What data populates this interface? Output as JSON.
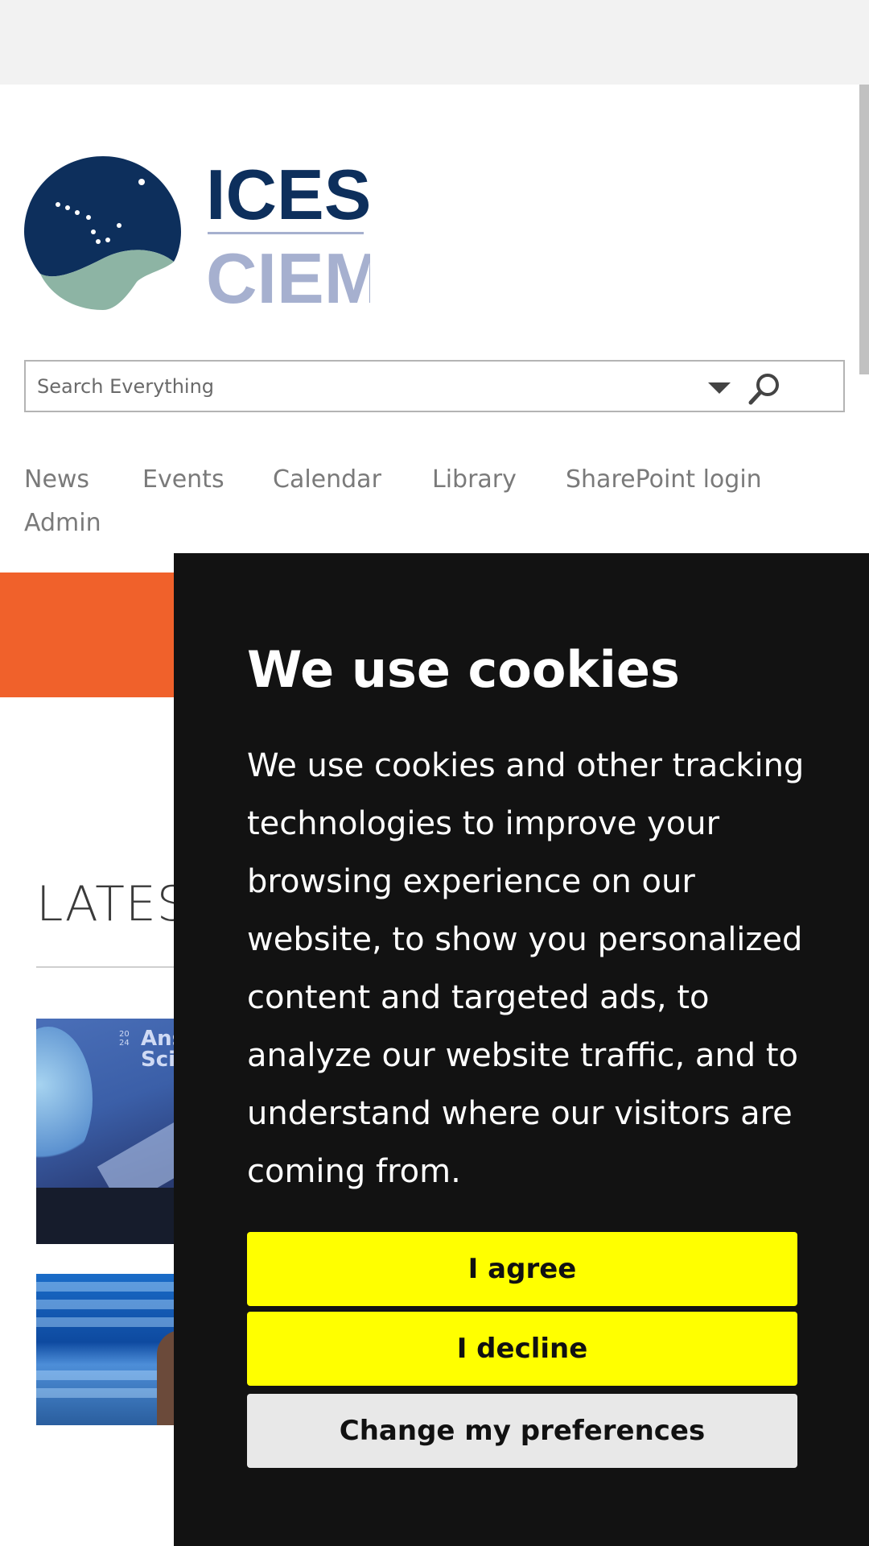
{
  "logo": {
    "line1": "ICES",
    "line2": "CIEM",
    "colors": {
      "navy": "#0d2f5c",
      "green": "#8db4a4",
      "lavender": "#a6b0cf"
    }
  },
  "search": {
    "placeholder": "Search Everything",
    "dropdown_icon": "caret-down-icon",
    "search_icon": "search-icon"
  },
  "nav": {
    "items": [
      "News",
      "Events",
      "Calendar",
      "Library",
      "SharePoint login",
      "Admin"
    ]
  },
  "colors": {
    "orange_band": "#f0612b",
    "cookie_bg": "#121212",
    "button_yellow": "#ffff00",
    "button_grey": "#e8e8e8"
  },
  "main": {
    "section_title": "LATEST"
  },
  "thumbnails": [
    {
      "text": "Ans Sci Co",
      "year": "20 24"
    }
  ],
  "cookie_banner": {
    "title": "We use cookies",
    "body": "We use cookies and other tracking technologies to improve your browsing experience on our website, to show you personalized content and targeted ads, to analyze our website traffic, and to understand where our visitors are coming from.",
    "agree_label": "I agree",
    "decline_label": "I decline",
    "preferences_label": "Change my preferences"
  }
}
